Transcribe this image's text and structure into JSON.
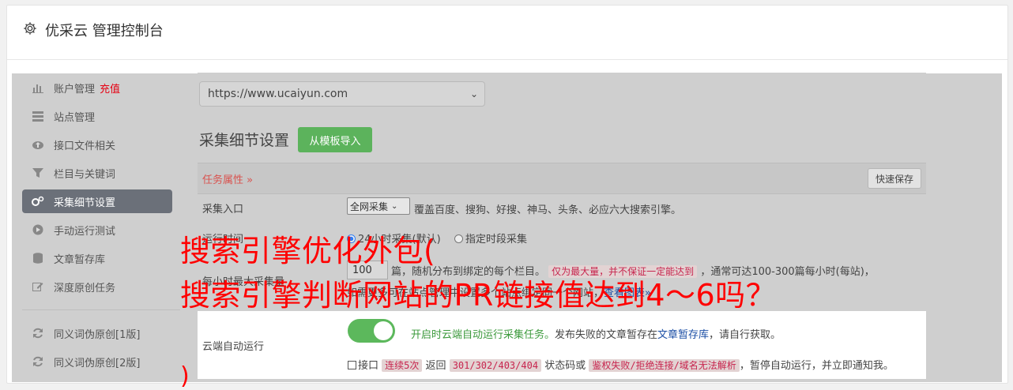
{
  "header": {
    "title": "优采云 管理控制台",
    "icon": "gear-icon"
  },
  "sidebar": {
    "items": [
      {
        "label": "账户管理",
        "badge": "充值",
        "icon": "bar-chart-icon"
      },
      {
        "label": "站点管理",
        "icon": "server-icon"
      },
      {
        "label": "接口文件相关",
        "icon": "cloud-upload-icon"
      },
      {
        "label": "栏目与关键词",
        "icon": "filter-icon"
      },
      {
        "label": "采集细节设置",
        "icon": "gears-icon",
        "active": true
      },
      {
        "label": "手动运行测试",
        "icon": "play-circle-icon"
      },
      {
        "label": "文章暂存库",
        "icon": "database-icon"
      },
      {
        "label": "深度原创任务",
        "icon": "edit-icon"
      }
    ],
    "extra_items": [
      {
        "label": "同义词伪原创[1版]",
        "icon": "refresh-icon"
      },
      {
        "label": "同义词伪原创[2版]",
        "icon": "refresh-icon"
      }
    ]
  },
  "main": {
    "site_select": {
      "value": "https://www.ucaiyun.com"
    },
    "section_title": "采集细节设置",
    "import_button": "从模板导入",
    "attr_label": "任务属性 »",
    "save_button": "快速保存",
    "rows": {
      "entry": {
        "label": "采集入口",
        "select_value": "全网采集",
        "desc": "覆盖百度、搜狗、好搜、神马、头条、必应六大搜索引擎。"
      },
      "time": {
        "label": "运行时间",
        "option1": "24小时采集(默认)",
        "option2": "指定时段采集"
      },
      "max": {
        "label": "每小时最大采集量",
        "value": "100",
        "text1": "篇，随机分布到绑定的每个栏目。",
        "tag": "仅为最大量，并不保证一定能达到",
        "text2": "，通常可达100-300篇每小时(每站)，",
        "text3": "如需更多可在站点管理中设置多个站点绑定同一个网站，",
        "link": "查看图表"
      },
      "cloud": {
        "label": "云端自动运行",
        "toggle_on": true,
        "desc_green": "开启时云端自动运行采集任务。",
        "desc_rest": "发布失败的文章暂存在",
        "desc_link": "文章暂存库",
        "desc_end": "，请自行获取。",
        "cb_label": "接口",
        "tag1": "连续5次",
        "t1": "返回",
        "tag2": "301/302/403/404",
        "t2": "状态码或",
        "tag3": "鉴权失败/拒绝连接/域名无法解析",
        "t3": "，暂停自动运行，并立即通知我。"
      }
    }
  },
  "overlay": {
    "line1": "搜索引擎优化外包(",
    "line2": "搜索引擎判断网站的PR链接值达到4～6吗？",
    "tail": ")"
  },
  "colors": {
    "accent_green": "#5cb85c",
    "badge_red": "#e60012",
    "overlay_red": "#ff0000"
  }
}
